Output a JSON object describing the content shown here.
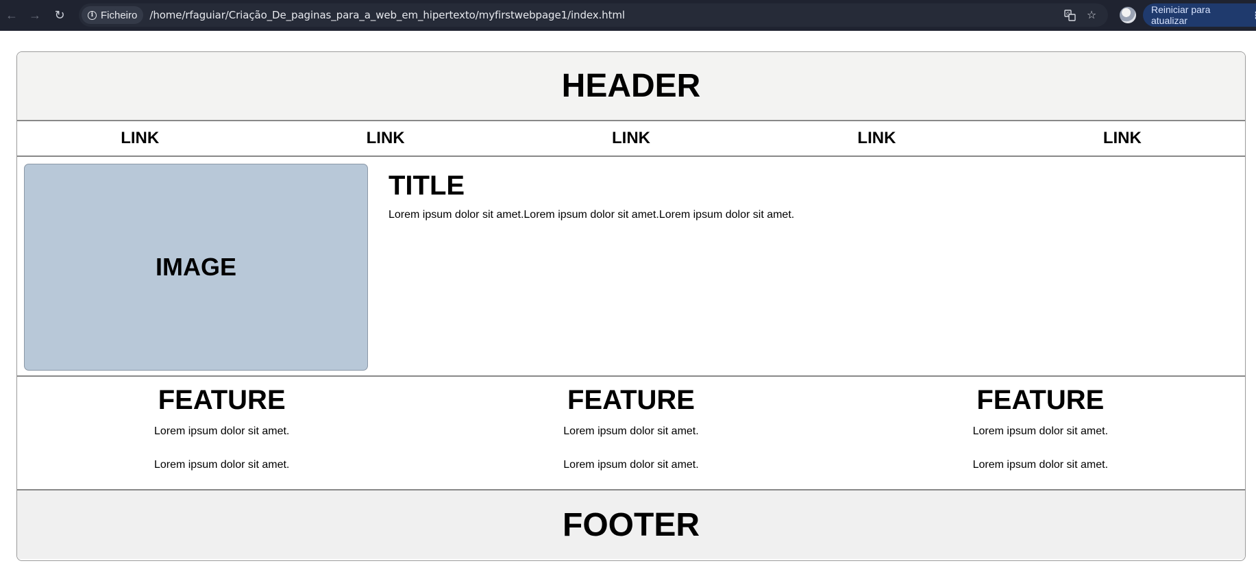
{
  "browser": {
    "back_icon": "back-arrow-icon",
    "forward_icon": "forward-arrow-icon",
    "reload_icon": "reload-icon",
    "site_info_label": "Ficheiro",
    "url": "/home/rfaguiar/Criação_De_paginas_para_a_web_em_hipertexto/myfirstwebpage1/index.html",
    "update_button_label": "Reiniciar para atualizar"
  },
  "page": {
    "header": "HEADER",
    "nav_links": [
      "LINK",
      "LINK",
      "LINK",
      "LINK",
      "LINK"
    ],
    "image_placeholder": "IMAGE",
    "title": "TITLE",
    "body_text": "Lorem ipsum dolor sit amet.Lorem ipsum dolor sit amet.Lorem ipsum dolor sit amet.",
    "features": [
      {
        "heading": "FEATURE",
        "lines": [
          "Lorem ipsum dolor sit amet.",
          "Lorem ipsum dolor sit amet."
        ]
      },
      {
        "heading": "FEATURE",
        "lines": [
          "Lorem ipsum dolor sit amet.",
          "Lorem ipsum dolor sit amet."
        ]
      },
      {
        "heading": "FEATURE",
        "lines": [
          "Lorem ipsum dolor sit amet.",
          "Lorem ipsum dolor sit amet."
        ]
      }
    ],
    "footer": "FOOTER"
  },
  "colors": {
    "toolbar_bg": "#1f2330",
    "header_bg": "#f3f3f2",
    "image_bg": "#b8c8d8",
    "footer_bg": "#f0f0f0",
    "update_button_bg": "#1f3a6d"
  }
}
